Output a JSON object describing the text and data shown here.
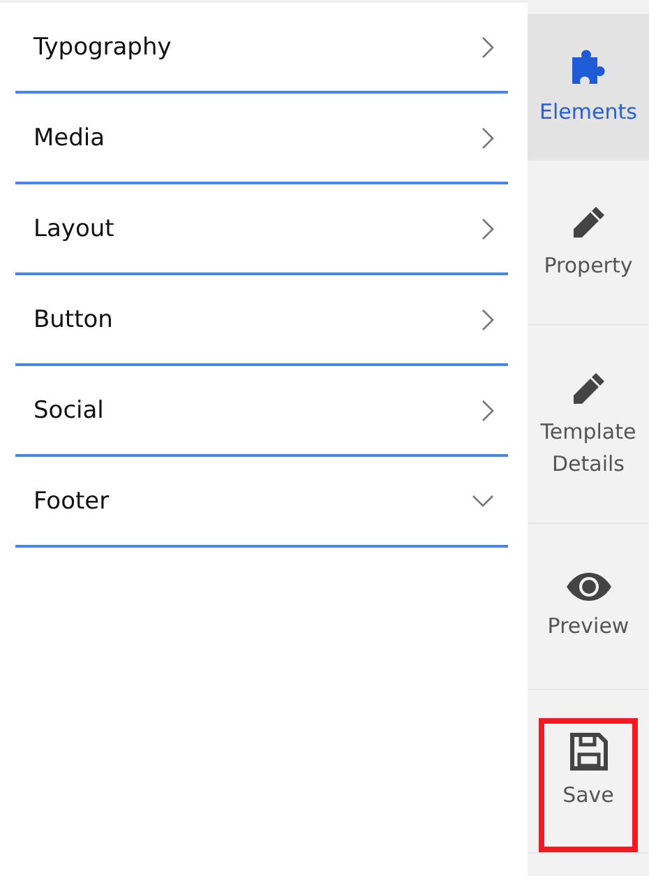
{
  "sections": [
    {
      "label": "Typography",
      "expanded": false
    },
    {
      "label": "Media",
      "expanded": false
    },
    {
      "label": "Layout",
      "expanded": false
    },
    {
      "label": "Button",
      "expanded": false
    },
    {
      "label": "Social",
      "expanded": false
    },
    {
      "label": "Footer",
      "expanded": true
    }
  ],
  "sidebar": {
    "items": [
      {
        "kind": "puzzle",
        "label": "Elements",
        "selected": true,
        "highlighted": false
      },
      {
        "kind": "pencil",
        "label": "Property",
        "selected": false,
        "highlighted": false
      },
      {
        "kind": "pencil",
        "label": "Template Details",
        "selected": false,
        "highlighted": false
      },
      {
        "kind": "eye",
        "label": "Preview",
        "selected": false,
        "highlighted": false
      },
      {
        "kind": "save",
        "label": "Save",
        "selected": false,
        "highlighted": true
      }
    ]
  }
}
